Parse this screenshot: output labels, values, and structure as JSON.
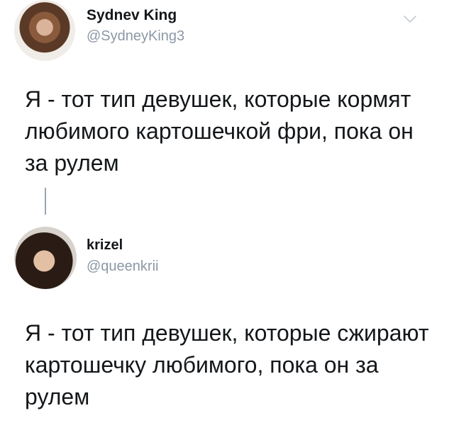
{
  "tweets": [
    {
      "name": "Sydnev King",
      "handle": "@SydneyKing3",
      "text": "Я - тот тип девушек, которые кормят любимого картошечкой фри, пока он за рулем"
    },
    {
      "name": "krizel",
      "handle": "@queenkrii",
      "text": "Я - тот тип девушек, которые сжирают картошечку любимого, пока он за рулем"
    }
  ],
  "icons": {
    "menu": "chevron-down-icon"
  }
}
